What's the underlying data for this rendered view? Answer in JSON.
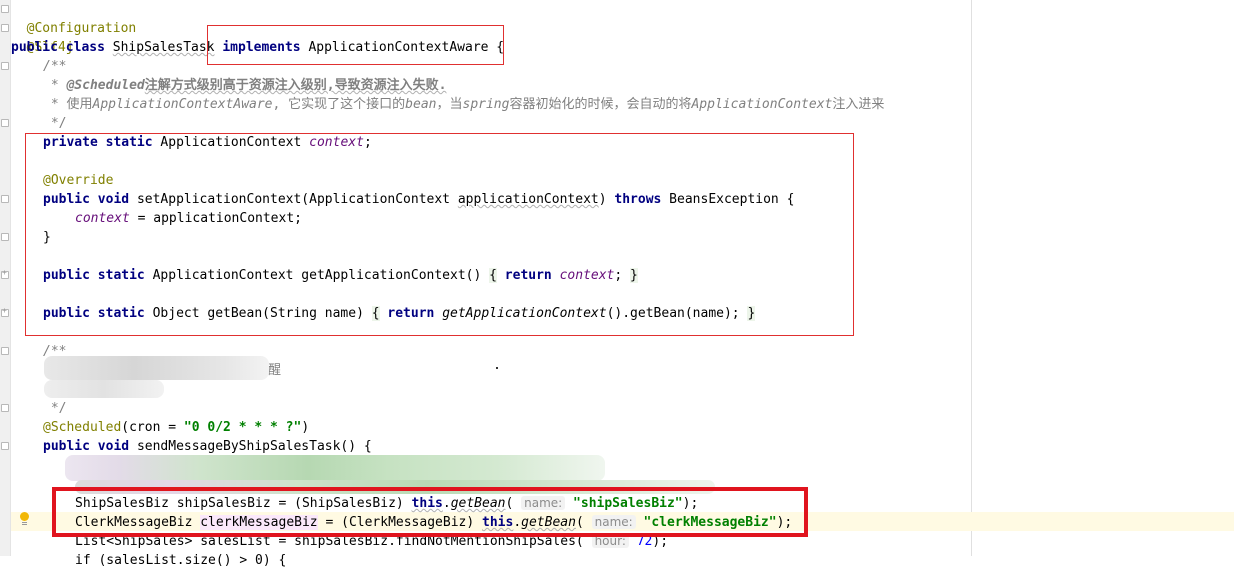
{
  "editor": {
    "annotation_configuration": "@Configuration",
    "annotation_slf4j": "@Slf4j",
    "class_decl": {
      "kw_public": "public",
      "kw_class": "class",
      "class_name": "ShipSalesTask",
      "kw_implements": "implements",
      "interface": "ApplicationContextAware",
      "brace": "{"
    },
    "doc1": {
      "open": "/**",
      "line1_star": " * ",
      "line1_tag": "@Scheduled",
      "line1_text": "注解方式级别高于资源注入级别,导致资源注入失败.",
      "line2_star": " * ",
      "line2_a": "使用",
      "line2_b": "ApplicationContextAware",
      "line2_c": ", 它实现了这个接口的",
      "line2_d": "bean",
      "line2_e": "，当",
      "line2_f": "spring",
      "line2_g": "容器初始化的时候，会自动的将",
      "line2_h": "ApplicationContext",
      "line2_i": "注入进来",
      "close": " */"
    },
    "field_decl": {
      "kw_private": "private",
      "kw_static": "static",
      "type": "ApplicationContext",
      "name": "context",
      "semi": ";"
    },
    "override": "@Override",
    "setter": {
      "kw_public": "public",
      "kw_void": "void",
      "sig_a": "setApplicationContext(ApplicationContext ",
      "param": "applicationContext",
      "sig_b": ") ",
      "kw_throws": "throws",
      "sig_c": " BeansException {",
      "body_field": "context",
      "body_rest": " = applicationContext;",
      "close": "}"
    },
    "getter": {
      "kw_public": "public",
      "kw_static": "static",
      "sig": "ApplicationContext getApplicationContext() ",
      "open": "{",
      "kw_return": "return",
      "field": "context",
      "semi": ";",
      "close": "}"
    },
    "getbean": {
      "kw_public": "public",
      "kw_static": "static",
      "sig": "Object getBean(String name) ",
      "open": "{",
      "kw_return": "return",
      "call": "getApplicationContext",
      "rest": "().getBean(name);",
      "close": "}"
    },
    "doc2": {
      "open": "/**",
      "visible_fragment": "提醒",
      "close": " */"
    },
    "scheduled": {
      "ann": "@Scheduled",
      "a": "(cron = ",
      "cron": "\"0 0/2 * * * ?\"",
      "b": ")"
    },
    "method_decl": {
      "kw_public": "public",
      "kw_void": "void",
      "sig": "sendMessageByShipSalesTask() {"
    },
    "line_ship": {
      "a": "ShipSalesBiz shipSalesBiz = (ShipSalesBiz) ",
      "kw_this": "this",
      "dot": ".",
      "call": "getBean",
      "paren": "(",
      "hint": "name:",
      "arg": "\"shipSalesBiz\"",
      "end": ");"
    },
    "line_clerk": {
      "type": "ClerkMessageBiz ",
      "var": "clerkMessageBiz",
      "a": " = (ClerkMessageBiz) ",
      "kw_this": "this",
      "dot": ".",
      "call": "getBean",
      "paren": "(",
      "hint": "name:",
      "arg": "\"clerkMessageBiz\"",
      "end": ");"
    },
    "line_list": {
      "a": "List<ShipSales> salesList = shipSalesBiz.findNotMentionShipSales(",
      "hint": "hour:",
      "num": "72",
      "end": ");"
    },
    "line_partial": "if (salesList.size() > 0) {"
  },
  "colors": {
    "keyword": "#000080",
    "annotation": "#808000",
    "string": "#008000",
    "field": "#660e7a",
    "comment": "#808080",
    "highlight_box_thin": "#e03030",
    "highlight_box_thick": "#e0141e"
  }
}
